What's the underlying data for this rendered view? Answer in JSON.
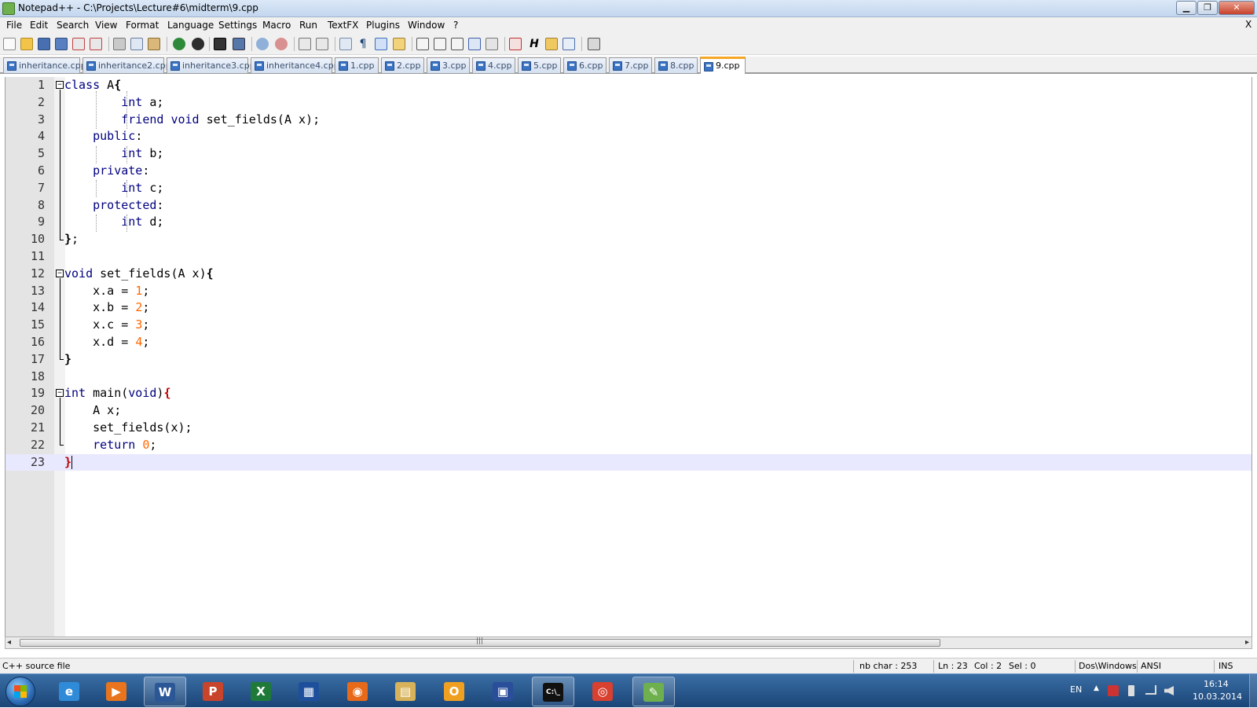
{
  "window": {
    "title": "Notepad++ - C:\\Projects\\Lecture#6\\midterm\\9.cpp",
    "minimize": "▁",
    "maximize": "❐",
    "close": "✕"
  },
  "menu": {
    "items": [
      "File",
      "Edit",
      "Search",
      "View",
      "Format",
      "Language",
      "Settings",
      "Macro",
      "Run",
      "TextFX",
      "Plugins",
      "Window",
      "?"
    ],
    "close_doc": "X"
  },
  "tabs": [
    {
      "label": "inheritance.cpp",
      "active": false
    },
    {
      "label": "inheritance2.cpp",
      "active": false
    },
    {
      "label": "inheritance3.cpp",
      "active": false
    },
    {
      "label": "inheritance4.cpp",
      "active": false
    },
    {
      "label": "1.cpp",
      "active": false
    },
    {
      "label": "2.cpp",
      "active": false
    },
    {
      "label": "3.cpp",
      "active": false
    },
    {
      "label": "4.cpp",
      "active": false
    },
    {
      "label": "5.cpp",
      "active": false
    },
    {
      "label": "6.cpp",
      "active": false
    },
    {
      "label": "7.cpp",
      "active": false
    },
    {
      "label": "8.cpp",
      "active": false
    },
    {
      "label": "9.cpp",
      "active": true
    }
  ],
  "editor": {
    "line_numbers": [
      "1",
      "2",
      "3",
      "4",
      "5",
      "6",
      "7",
      "8",
      "9",
      "10",
      "11",
      "12",
      "13",
      "14",
      "15",
      "16",
      "17",
      "18",
      "19",
      "20",
      "21",
      "22",
      "23"
    ],
    "lines": [
      "class A{",
      "        int a;",
      "        friend void set_fields(A x);",
      "    public:",
      "        int b;",
      "    private:",
      "        int c;",
      "    protected:",
      "        int d;",
      "};",
      "",
      "void set_fields(A x){",
      "    x.a = 1;",
      "    x.b = 2;",
      "    x.c = 3;",
      "    x.d = 4;",
      "}",
      "",
      "int main(void){",
      "    A x;",
      "    set_fields(x);",
      "    return 0;",
      "}"
    ],
    "current_line": 23,
    "fold_marker": "−"
  },
  "scrollbar": {
    "left_arrow": "◂",
    "right_arrow": "▸",
    "grip": "|||"
  },
  "status": {
    "file_type": "C++ source file",
    "nb_char": "nb char : 253",
    "ln": "Ln : 23",
    "col": "Col : 2",
    "sel": "Sel : 0",
    "eol": "Dos\\Windows",
    "encoding": "ANSI",
    "mode": "INS"
  },
  "taskbar": {
    "apps": [
      {
        "name": "internet-explorer",
        "glyph": "e",
        "color": "#2f8bd8",
        "open": false
      },
      {
        "name": "media-player",
        "glyph": "▶",
        "color": "#e8741d",
        "open": false
      },
      {
        "name": "word",
        "glyph": "W",
        "color": "#2b5797",
        "open": true
      },
      {
        "name": "powerpoint",
        "glyph": "P",
        "color": "#c8442b",
        "open": false
      },
      {
        "name": "excel",
        "glyph": "X",
        "color": "#1f7a3a",
        "open": false
      },
      {
        "name": "calculator-app",
        "glyph": "▦",
        "color": "#1e4f9c",
        "open": false
      },
      {
        "name": "firefox",
        "glyph": "◉",
        "color": "#e66a1a",
        "open": false
      },
      {
        "name": "explorer",
        "glyph": "▤",
        "color": "#d8b25a",
        "open": false
      },
      {
        "name": "outlook",
        "glyph": "O",
        "color": "#f0a020",
        "open": false
      },
      {
        "name": "visual-studio",
        "glyph": "▣",
        "color": "#2a4e9a",
        "open": false
      },
      {
        "name": "command-prompt",
        "glyph": "C:\\_",
        "color": "#111111",
        "open": true
      },
      {
        "name": "chrome",
        "glyph": "◎",
        "color": "#d84030",
        "open": false
      },
      {
        "name": "notepad-plus-plus",
        "glyph": "✎",
        "color": "#6fb04e",
        "open": true
      }
    ],
    "language": "EN",
    "tray_arrow": "▲",
    "time": "16:14",
    "date": "10.03.2014"
  }
}
